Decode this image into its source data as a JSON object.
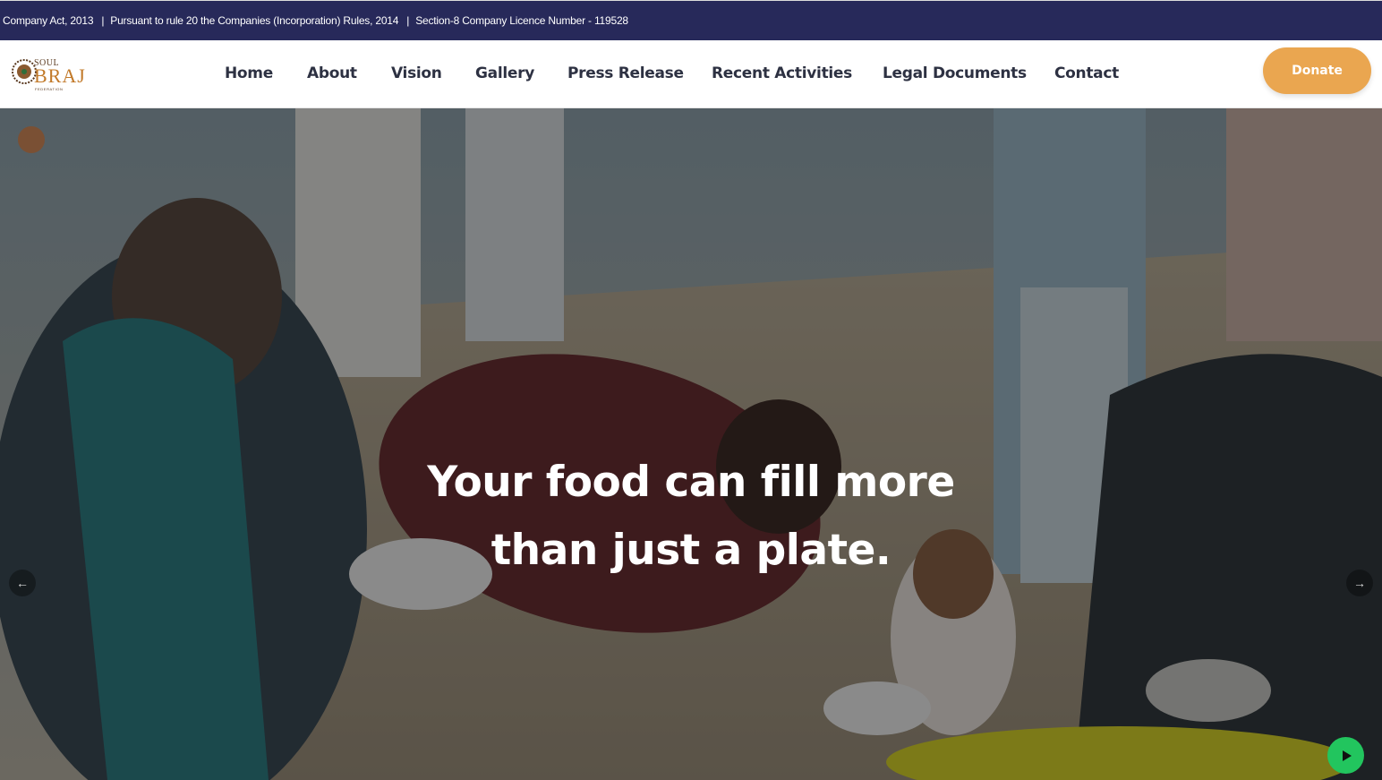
{
  "topbar": {
    "items": [
      "Company Act, 2013",
      "Pursuant to rule 20 the Companies (Incorporation) Rules, 2014",
      "Section-8 Company Licence Number - 119528"
    ],
    "separator": "|"
  },
  "logo": {
    "soul": "SOUL",
    "of": "OF",
    "braj": "BRAJ",
    "federation": "FEDERATION"
  },
  "nav": {
    "items": [
      "Home",
      "About",
      "Vision",
      "Gallery",
      "Press Release",
      "Recent Activities",
      "Legal Documents",
      "Contact"
    ]
  },
  "donate": {
    "label": "Donate"
  },
  "hero": {
    "headline_line1": "Your food can fill more",
    "headline_line2": "than just a plate.",
    "prev_icon": "arrow-left-icon",
    "next_icon": "arrow-right-icon",
    "play_icon": "play-icon"
  },
  "colors": {
    "topbar_bg": "#27295a",
    "donate_bg": "#eaa650",
    "nav_text": "#2d3142",
    "play_bg": "#22c55e"
  }
}
